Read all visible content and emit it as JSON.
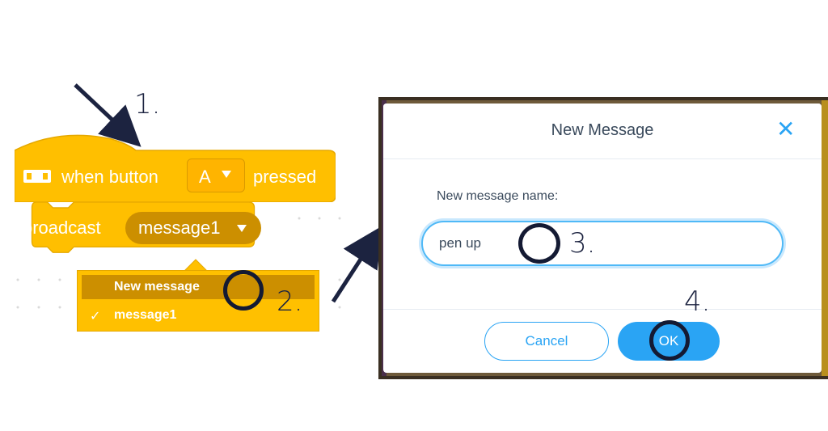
{
  "steps": [
    "1.",
    "2.",
    "3.",
    "4."
  ],
  "hat_block": {
    "when_label": "when button",
    "button_value": "A",
    "pressed_label": "pressed",
    "icon": "gamepad-icon"
  },
  "broadcast_block": {
    "label": "broadcast",
    "message_value": "message1"
  },
  "dropdown_menu": {
    "items": [
      {
        "label": "New message",
        "highlighted": true
      },
      {
        "label": "message1",
        "checked": true,
        "check_mark": "✓"
      }
    ]
  },
  "dialog": {
    "title": "New Message",
    "close_glyph": "✕",
    "field_label": "New message name:",
    "input_value": "pen up",
    "cancel_label": "Cancel",
    "ok_label": "OK"
  },
  "colors": {
    "block_yellow": "#ffbf00",
    "block_dark": "#cc8f00",
    "accent_blue": "#2aa4f4",
    "annotation_navy": "#1c2340"
  }
}
